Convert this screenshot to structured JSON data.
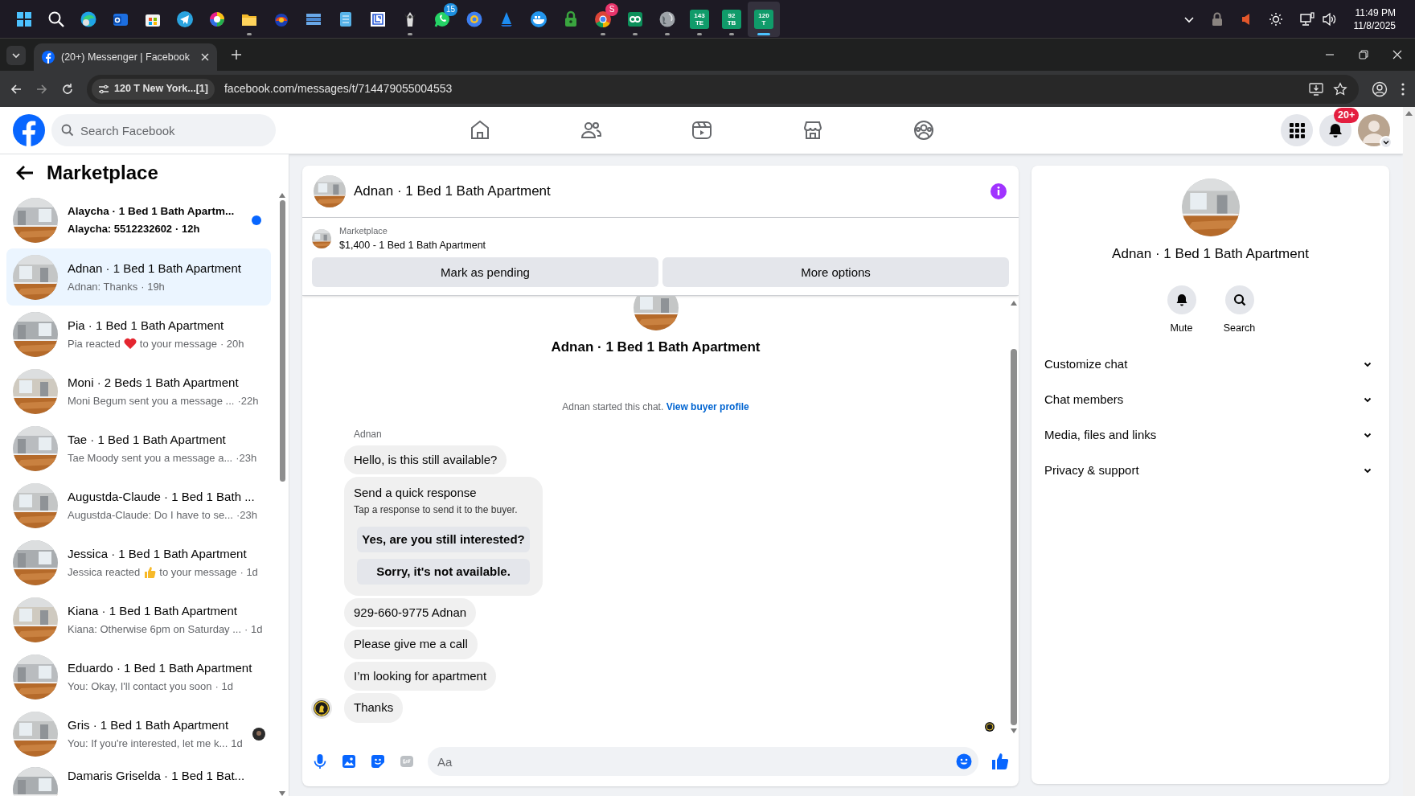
{
  "taskbar": {
    "apps": [
      {
        "running": false
      },
      {
        "running": false
      },
      {
        "running": false
      },
      {
        "running": false
      },
      {
        "running": false
      },
      {
        "running": false
      },
      {
        "running": false
      },
      {
        "running": true
      },
      {
        "running": false
      },
      {
        "running": false
      },
      {
        "running": false
      },
      {
        "running": false
      },
      {
        "running": true
      },
      {
        "running": false,
        "badge": "15"
      },
      {
        "running": false
      },
      {
        "running": false
      },
      {
        "running": false
      },
      {
        "running": false
      },
      {
        "running": true,
        "badge": "S"
      },
      {
        "running": true
      },
      {
        "running": true
      }
    ],
    "tiles": [
      {
        "lines": [
          "143",
          "TE"
        ],
        "selected": false
      },
      {
        "lines": [
          "92",
          "TB"
        ],
        "selected": false
      },
      {
        "lines": [
          "120",
          "T"
        ],
        "selected": true
      }
    ],
    "time": "11:49 PM",
    "date": "11/8/2025"
  },
  "browser": {
    "tab_title": "(20+) Messenger | Facebook",
    "site_chip": "120 T New York...[1]",
    "url": "facebook.com/messages/t/714479055004553"
  },
  "header": {
    "search_placeholder": "Search Facebook",
    "notification_badge": "20+"
  },
  "sidebar": {
    "title": "Marketplace",
    "conversations": [
      {
        "name": "Alaycha · 1 Bed 1 Bath Apartm...",
        "preview": "Alaycha: 5512232602",
        "time": "· 12h",
        "unread": true,
        "selected": false
      },
      {
        "name": "Adnan · 1 Bed 1 Bath Apartment",
        "preview": "Adnan: Thanks",
        "time": "· 19h",
        "unread": false,
        "selected": true
      },
      {
        "name": "Pia · 1 Bed 1 Bath Apartment",
        "kind": "heart_reaction",
        "preview": "Pia reacted",
        "preview_after": "to your message",
        "time": "· 20h",
        "unread": false,
        "selected": false
      },
      {
        "name": "Moni · 2 Beds 1 Bath Apartment",
        "preview": "Moni Begum sent you a message ...",
        "time": "·22h",
        "unread": false,
        "selected": false
      },
      {
        "name": "Tae · 1 Bed 1 Bath Apartment",
        "preview": "Tae Moody sent you a message a...",
        "time": "·23h",
        "unread": false,
        "selected": false
      },
      {
        "name": "Augustda-Claude · 1 Bed 1 Bath ...",
        "preview": "Augustda-Claude: Do I have to se...",
        "time": "·23h",
        "unread": false,
        "selected": false
      },
      {
        "name": "Jessica · 1 Bed 1 Bath Apartment",
        "kind": "like_reaction",
        "preview": "Jessica reacted",
        "preview_after": "to your message",
        "time": "· 1d",
        "unread": false,
        "selected": false
      },
      {
        "name": "Kiana · 1 Bed 1 Bath Apartment",
        "preview": "Kiana: Otherwise 6pm on Saturday ...",
        "time": "· 1d",
        "unread": false,
        "selected": false
      },
      {
        "name": "Eduardo · 1 Bed 1 Bath Apartment",
        "preview": "You: Okay, I'll contact you soon",
        "time": "· 1d",
        "unread": false,
        "selected": false
      },
      {
        "name": "Gris · 1 Bed 1 Bath Apartment",
        "preview": "You: If you're interested, let me k...",
        "time": "1d",
        "unread": false,
        "selected": false,
        "seen": true
      },
      {
        "name": "Damaris Griselda · 1 Bed 1 Bat...",
        "unread": false,
        "selected": false
      }
    ]
  },
  "chat": {
    "title": "Adnan · 1 Bed 1 Bath Apartment",
    "listing": {
      "label": "Marketplace",
      "item": "$1,400 - 1 Bed 1 Bath Apartment",
      "buttons": [
        "Mark as pending",
        "More options"
      ]
    },
    "intro": {
      "title": "Adnan · 1 Bed 1 Bath Apartment",
      "started": "Adnan started this chat.",
      "link": "View buyer profile"
    },
    "sender": "Adnan",
    "messages": [
      {
        "kind": "text",
        "text": "Hello, is this still available?"
      },
      {
        "kind": "quick_response",
        "title": "Send a quick response",
        "subtitle": "Tap a response to send it to the buyer.",
        "options": [
          "Yes, are you still interested?",
          "Sorry, it's not available."
        ]
      },
      {
        "kind": "text",
        "text": "929-660-9775 Adnan"
      },
      {
        "kind": "text",
        "text": "Please give me a call"
      },
      {
        "kind": "text",
        "text": "I’m looking for apartment"
      },
      {
        "kind": "text",
        "text": "Thanks"
      }
    ],
    "composer": {
      "placeholder": "Aa"
    }
  },
  "details": {
    "title": "Adnan · 1 Bed 1 Bath Apartment",
    "actions": [
      {
        "kind": "mute",
        "label": "Mute"
      },
      {
        "kind": "search",
        "label": "Search"
      }
    ],
    "sections": [
      {
        "label": "Customize chat",
        "expanded": false
      },
      {
        "label": "Chat members",
        "expanded": false
      },
      {
        "label": "Media, files and links",
        "expanded": false
      },
      {
        "label": "Privacy & support",
        "expanded": false
      }
    ]
  }
}
